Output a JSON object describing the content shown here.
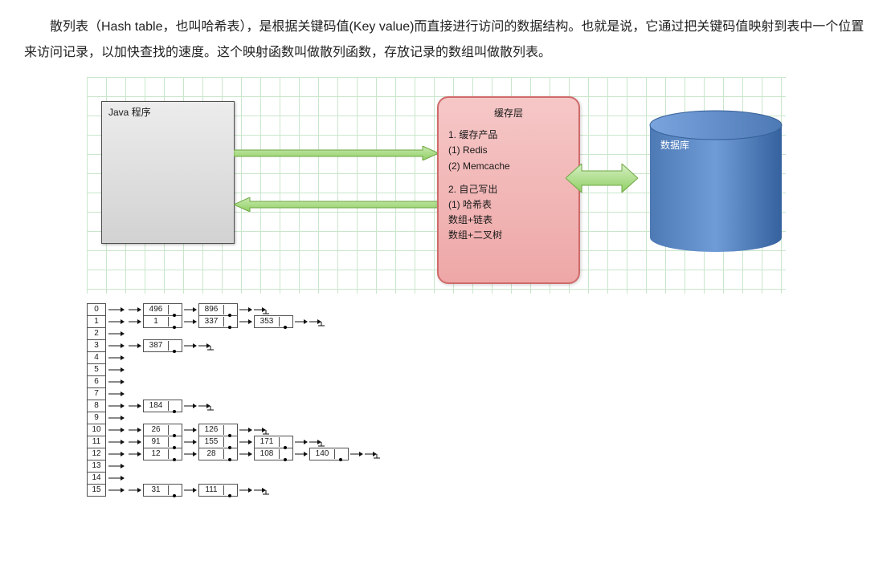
{
  "paragraph": "散列表（Hash table，也叫哈希表），是根据关键码值(Key value)而直接进行访问的数据结构。也就是说，它通过把关键码值映射到表中一个位置来访问记录，以加快查找的速度。这个映射函数叫做散列函数，存放记录的数组叫做散列表。",
  "diagram": {
    "java_title": "Java 程序",
    "cache": {
      "title": "缓存层",
      "line1": "1. 缓存产品",
      "line2": "(1) Redis",
      "line3": "(2) Memcache",
      "line4": "2. 自己写出",
      "line5": "(1) 哈希表",
      "line6": "数组+链表",
      "line7": "数组+二叉树"
    },
    "db_label": "数据库"
  },
  "hash": {
    "buckets": [
      {
        "index": 0,
        "chain": [
          496,
          896
        ]
      },
      {
        "index": 1,
        "chain": [
          1,
          337,
          353
        ]
      },
      {
        "index": 2,
        "chain": []
      },
      {
        "index": 3,
        "chain": [
          387
        ]
      },
      {
        "index": 4,
        "chain": []
      },
      {
        "index": 5,
        "chain": []
      },
      {
        "index": 6,
        "chain": []
      },
      {
        "index": 7,
        "chain": []
      },
      {
        "index": 8,
        "chain": [
          184
        ]
      },
      {
        "index": 9,
        "chain": []
      },
      {
        "index": 10,
        "chain": [
          26,
          126
        ]
      },
      {
        "index": 11,
        "chain": [
          91,
          155,
          171
        ]
      },
      {
        "index": 12,
        "chain": [
          12,
          28,
          108,
          140
        ]
      },
      {
        "index": 13,
        "chain": []
      },
      {
        "index": 14,
        "chain": []
      },
      {
        "index": 15,
        "chain": [
          31,
          111
        ]
      }
    ]
  }
}
